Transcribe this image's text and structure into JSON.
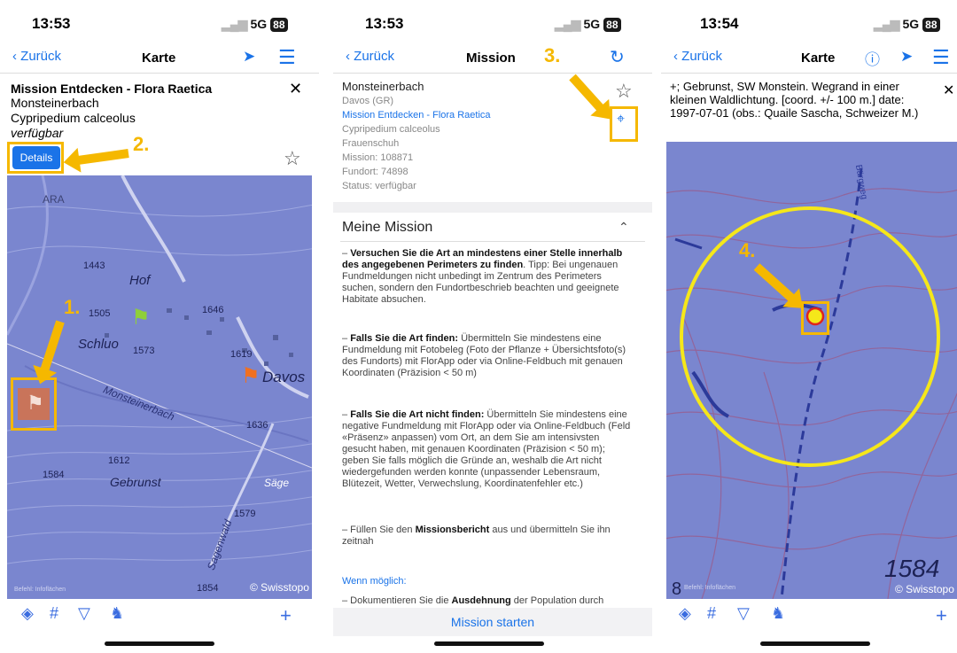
{
  "common": {
    "back_label": "Zurück",
    "network": "5G",
    "battery": "88"
  },
  "screen1": {
    "time": "13:53",
    "title": "Karte",
    "mission_title": "Mission Entdecken - Flora Raetica",
    "place": "Monsteinerbach",
    "species": "Cypripedium calceolus",
    "status": "verfügbar",
    "details_label": "Details",
    "step1": "1.",
    "step2": "2.",
    "map_labels": {
      "ara": "ARA",
      "hof": "Hof",
      "schluo": "Schluo",
      "davos": "Davos",
      "monsteinerbach": "Monsteinerbach",
      "gebrunst": "Gebrunst",
      "saege": "Säge",
      "sagenwald": "Sagenwald",
      "alt1443": "1443",
      "alt1505": "1505",
      "alt1573": "1573",
      "alt1646": "1646",
      "alt1619": "1619",
      "alt1636": "1636",
      "alt1612": "1612",
      "alt1584": "1584",
      "alt1579": "1579",
      "alt1854": "1854",
      "copyright": "© Swisstopo",
      "info": "Befehl: Infoflächen"
    }
  },
  "screen2": {
    "time": "13:53",
    "title": "Mission",
    "step3": "3.",
    "place": "Monsteinerbach",
    "region": "Davos (GR)",
    "mission_link": "Mission Entdecken - Flora Raetica",
    "species": "Cypripedium calceolus",
    "common_name": "Frauenschuh",
    "mission_id": "Mission: 108871",
    "fundort_id": "Fundort: 74898",
    "status": "Status: verfügbar",
    "section_title": "Meine Mission",
    "p1_bold": "Versuchen Sie die Art an mindestens einer Stelle innerhalb des angegebenen Perimeters zu finden",
    "p1_rest": ". Tipp: Bei ungenauen Fundmeldungen nicht unbedingt im Zentrum des Perimeters suchen, sondern den Fundortbeschrieb beachten und geeignete Habitate absuchen.",
    "p2_bold": "Falls Sie die Art finden:",
    "p2_rest": " Übermitteln Sie mindestens eine Fundmeldung mit Fotobeleg (Foto der Pflanze + Übersichtsfoto(s) des Fundorts) mit FlorApp oder via Online-Feldbuch mit genauen Koordinaten (Präzision < 50 m)",
    "p3_bold": "Falls Sie die Art nicht finden:",
    "p3_rest": " Übermitteln Sie mindestens eine negative Fundmeldung mit FlorApp oder via Online-Feldbuch (Feld «Präsenz» anpassen) vom Ort, an dem Sie am intensivsten gesucht haben, mit genauen Koordinaten (Präzision < 50 m); geben Sie falls möglich die Gründe an, weshalb die Art nicht wiedergefunden werden konnte (unpassender Lebensraum, Blütezeit, Wetter, Verwechslung, Koordinatenfehler etc.)",
    "p4_pre": "– Füllen Sie den ",
    "p4_bold": "Missionsbericht",
    "p4_rest": " aus und übermitteln Sie ihn zeitnah",
    "wenn": "Wenn möglich:",
    "p5_pre": "– Dokumentieren Sie die ",
    "p5_bold": "Ausdehnung",
    "p5_rest": " der Population durch",
    "start_label": "Mission starten"
  },
  "screen3": {
    "time": "13:54",
    "title": "Karte",
    "step4": "4.",
    "description": "+; Gebrunst, SW Monstein. Wegrand in einer kleinen Waldlichtung. [coord. +/- 100 m.] date: 1997-07-01 (obs.: Quaile Sascha, Schweizer M.)",
    "map_labels": {
      "alt1584": "1584",
      "copyright": "© Swisstopo",
      "info": "Befehl: Infoflächen",
      "road": "Bärgweg",
      "number8": "8"
    }
  }
}
